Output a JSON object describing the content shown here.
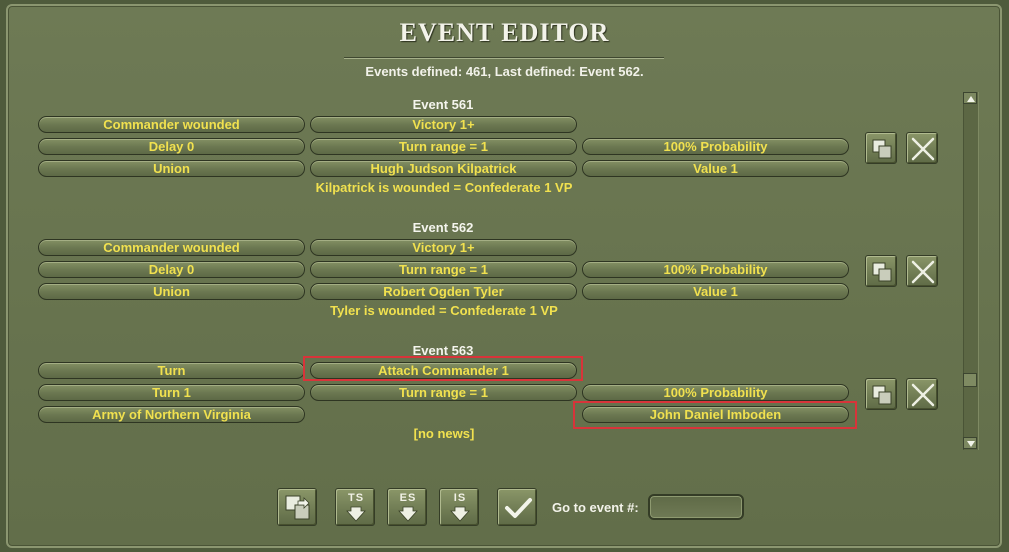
{
  "header": {
    "title": "EVENT EDITOR",
    "summary": "Events defined:  461, Last defined: Event  562."
  },
  "events": [
    {
      "title": "Event 561",
      "trigger": "Commander wounded",
      "effect": "Victory 1+",
      "delay": "Delay 0",
      "turn_range": "Turn range = 1",
      "probability": "100% Probability",
      "side": "Union",
      "target": "Hugh Judson Kilpatrick",
      "value": "Value 1",
      "news": "Kilpatrick is wounded = Confederate 1 VP"
    },
    {
      "title": "Event 562",
      "trigger": "Commander wounded",
      "effect": "Victory 1+",
      "delay": "Delay 0",
      "turn_range": "Turn range = 1",
      "probability": "100% Probability",
      "side": "Union",
      "target": "Robert Ogden Tyler",
      "value": "Value 1",
      "news": "Tyler is wounded = Confederate 1 VP"
    },
    {
      "title": "Event 563",
      "trigger": "Turn",
      "effect": "Attach Commander 1",
      "delay": "Turn 1",
      "turn_range": "Turn range = 1",
      "probability": "100% Probability",
      "side": "Army of Northern Virginia",
      "target": "",
      "value": "John Daniel Imboden",
      "news": "[no news]"
    }
  ],
  "toolbar": {
    "ts_label": "TS",
    "es_label": "ES",
    "is_label": "IS",
    "goto_label": "Go to event #:",
    "goto_value": ""
  },
  "colors": {
    "panel": "#68744f",
    "pill_text": "#f1e14f",
    "highlight": "#d8343a"
  }
}
